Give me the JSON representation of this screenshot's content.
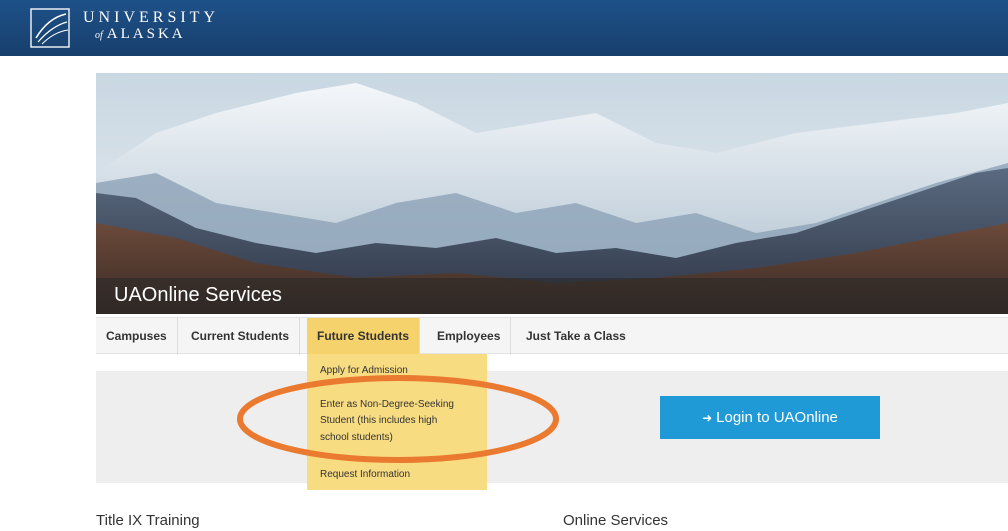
{
  "brand": {
    "line1": "UNIVERSITY",
    "of": "of",
    "line2": "ALASKA"
  },
  "hero": {
    "title": "UAOnline Services"
  },
  "nav": {
    "items": [
      {
        "label": "Campuses",
        "active": false
      },
      {
        "label": "Current Students",
        "active": false
      },
      {
        "label": "Future Students",
        "active": true
      },
      {
        "label": "Employees",
        "active": false
      },
      {
        "label": "Just Take a Class",
        "active": false
      }
    ]
  },
  "dropdown": {
    "items": [
      {
        "label": "Apply for Admission"
      },
      {
        "label": "Enter as Non-Degree-Seeking"
      },
      {
        "label": "Student (this includes high"
      },
      {
        "label": "school students)"
      },
      {
        "label": "Request Information"
      }
    ]
  },
  "login": {
    "label": "Login to UAOnline",
    "icon": "sign-in-icon"
  },
  "sections": {
    "left": "Title IX Training",
    "right": "Online Services"
  },
  "colors": {
    "header": "#1a4b80",
    "active_tab": "#f6d26c",
    "dropdown": "#f8dc82",
    "login": "#1f9ad6",
    "highlight": "#ea7a2f"
  }
}
